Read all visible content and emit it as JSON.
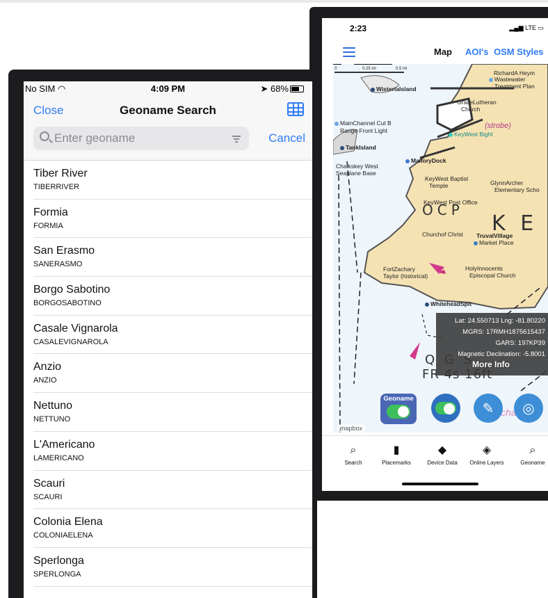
{
  "left_phone": {
    "status": {
      "carrier": "No SIM",
      "time": "4:09 PM",
      "battery": "68%"
    },
    "header": {
      "close_label": "Close",
      "title": "Geoname Search",
      "grid_icon": "table-grid-icon"
    },
    "search": {
      "placeholder": "Enter geoname",
      "value": "",
      "cancel_label": "Cancel"
    },
    "results": [
      {
        "name": "Tiber River",
        "code": "TIBERRIVER"
      },
      {
        "name": "Formia",
        "code": "FORMIA"
      },
      {
        "name": "San Erasmo",
        "code": "SANERASMO"
      },
      {
        "name": "Borgo Sabotino",
        "code": "BORGOSABOTINO"
      },
      {
        "name": "Casale Vignarola",
        "code": "CASALEVIGNAROLA"
      },
      {
        "name": "Anzio",
        "code": "ANZIO"
      },
      {
        "name": "Nettuno",
        "code": "NETTUNO"
      },
      {
        "name": "L'Americano",
        "code": "LAMERICANO"
      },
      {
        "name": "Scauri",
        "code": "SCAURI"
      },
      {
        "name": "Colonia Elena",
        "code": "COLONIAELENA"
      },
      {
        "name": "Sperlonga",
        "code": "SPERLONGA"
      }
    ]
  },
  "right_phone": {
    "status": {
      "time": "2:23",
      "network": "LTE"
    },
    "nav": {
      "map": "Map",
      "aois": "AOI's",
      "osm": "OSM Styles"
    },
    "scale": {
      "zero": "0",
      "quarter": "0.25 mi",
      "half": "0.5 mi"
    },
    "map_labels": {
      "richard": "RichardA Heym",
      "wastewater": "Wastewater",
      "treatment": "Treatment Plan",
      "wisteria": "WisteriaIsland",
      "grace": "GraceLutheran",
      "church": "Church",
      "mainchannel": "MainChannel Cut B",
      "rangefront": "Range Front Light",
      "keywestbight": "KeyWest Bight",
      "tankisland": "TankIsland",
      "mallory": "MalloryDock",
      "chalkskey": "Chalkskey West",
      "seaplane": "Seaplane Base",
      "baptist": "KeyWest Baptist",
      "temple": "Temple",
      "glynn": "GlynnArcher",
      "elementary": "Elementary Scho",
      "postoffice": "KeyWest Post Office",
      "churchofchrist": "Churchof Christ",
      "truval": "TruvalVillage",
      "market": "Market Place",
      "fortzachary": "FortZachary",
      "taylor": "Taylor (historical)",
      "holyinnocents": "HolyInnocents",
      "episcopal": "Episcopal Church",
      "whitehead": "WhiteheadSpit",
      "chart_ocp": "OCP",
      "chart_ke": "K E",
      "chart_qgs": "Q G S",
      "chart_fr": "FR 4s 16ft",
      "chart_strobe": "(strobe)",
      "chart_use": "(use chart 1"
    },
    "info": {
      "latlng": "Lat: 24.550713 Lng: -81.80220",
      "mgrs": "MGRS: 17RMH1875615437",
      "gars": "GARS: 197KP39",
      "declination": "Magnetic Declination: -5.8001",
      "more": "More Info"
    },
    "geoname_toggle_label": "Geoname",
    "mapbox": "mapbox",
    "tabs": [
      {
        "label": "Search",
        "icon": "search-icon"
      },
      {
        "label": "Placemarks",
        "icon": "bookmark-icon"
      },
      {
        "label": "Device Data",
        "icon": "layers-icon"
      },
      {
        "label": "Online Layers",
        "icon": "layers-plus-icon"
      },
      {
        "label": "Geoname",
        "icon": "search-icon"
      }
    ],
    "colors": {
      "accent": "#2f7cf6",
      "land": "#f5e2b3",
      "water": "#eef5fb",
      "fab": "#3d8ed6"
    }
  }
}
